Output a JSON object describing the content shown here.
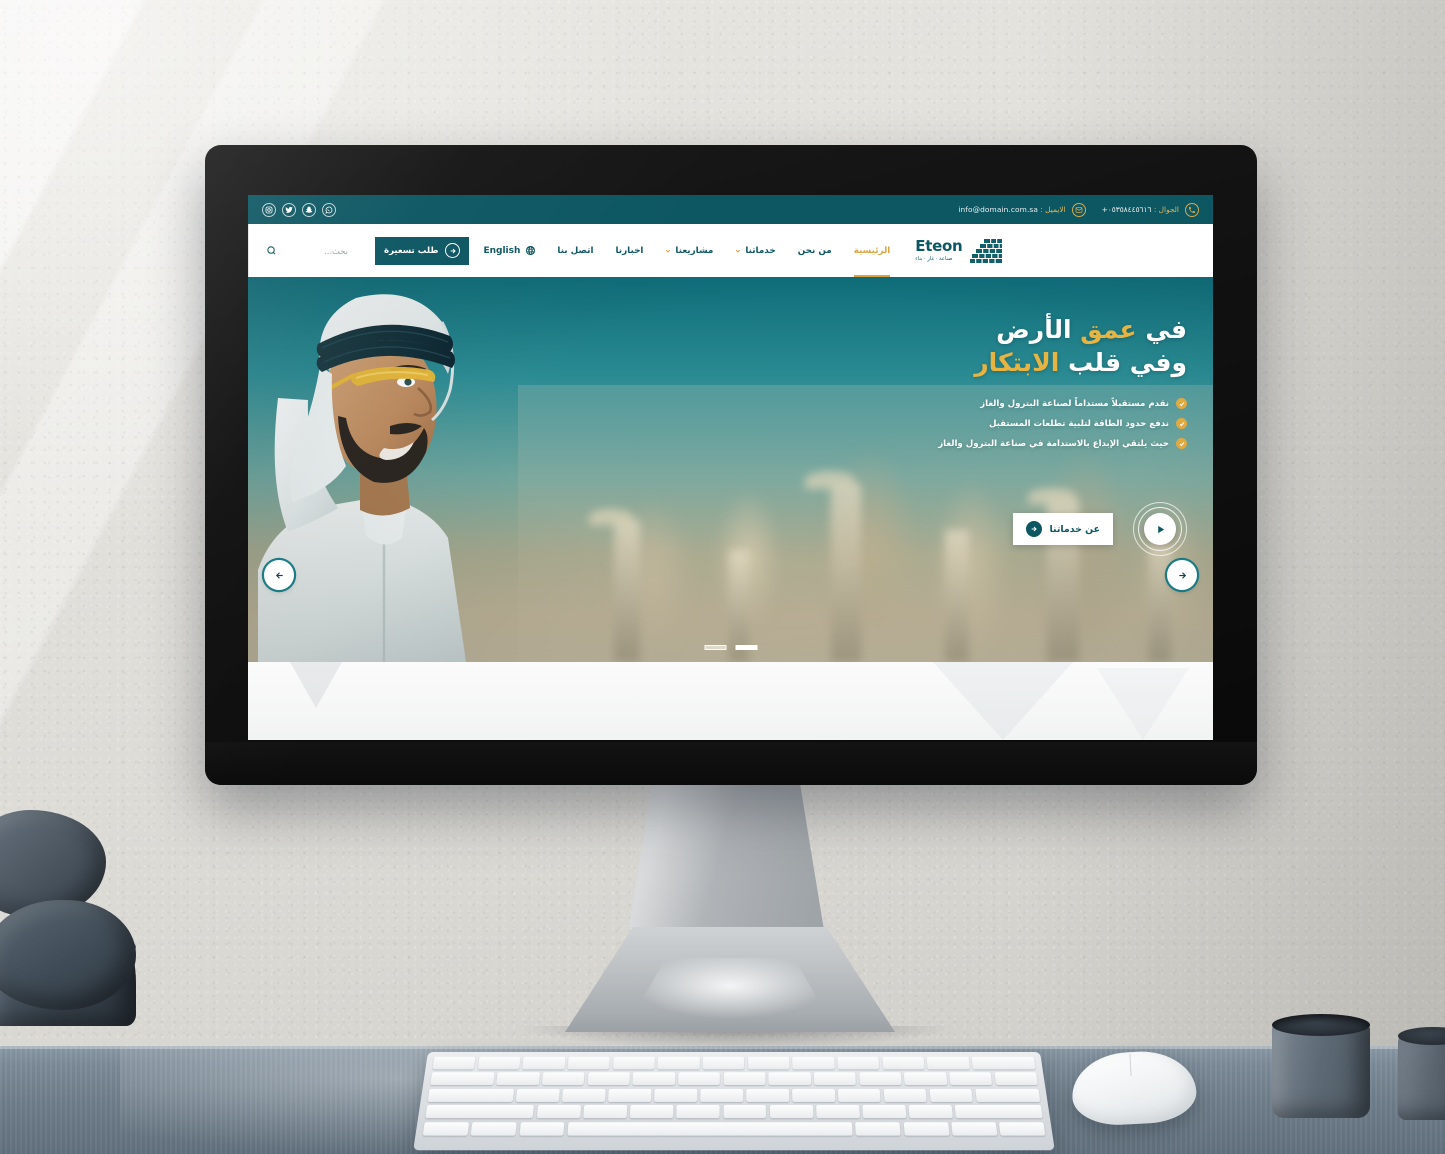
{
  "topbar": {
    "social": [
      {
        "name": "instagram-icon",
        "label": "Instagram"
      },
      {
        "name": "twitter-icon",
        "label": "Twitter"
      },
      {
        "name": "snapchat-icon",
        "label": "Snapchat"
      },
      {
        "name": "whatsapp-icon",
        "label": "WhatsApp"
      }
    ],
    "phone_label": "الجوال :",
    "phone_value": "٠٥٣٥٨٤٤٥٦١٦+",
    "email_label": "الايميل :",
    "email_value": "info@domain.com.sa"
  },
  "nav": {
    "search_placeholder": "بحث...",
    "quote_button": "طلب تسعيرة",
    "language": "English",
    "items": [
      {
        "label": "الرئيسية",
        "active": true,
        "dropdown": false
      },
      {
        "label": "من نحن",
        "active": false,
        "dropdown": false
      },
      {
        "label": "خدماتنا",
        "active": false,
        "dropdown": true
      },
      {
        "label": "مشاريعنا",
        "active": false,
        "dropdown": true
      },
      {
        "label": "اخبارنا",
        "active": false,
        "dropdown": false
      },
      {
        "label": "اتصل بنا",
        "active": false,
        "dropdown": false
      }
    ],
    "logo_name": "Eteon",
    "logo_sub": "صناعة · غاز · بناء"
  },
  "hero": {
    "headline_line1_pre": "في ",
    "headline_line1_gold": "عمق",
    "headline_line1_post": " الأرض",
    "headline_line2_pre": "وفي قلب ",
    "headline_line2_gold": "الابتكار",
    "bullets": [
      "نقدم مستقبلاً مستداماً لصناعة البترول والغاز",
      "ندفع حدود الطاقة لتلبية تطلعات المستقبل",
      "حيث يلتقي الإبداع بالاستدامة في صناعة البترول والغاز"
    ],
    "services_button": "عن خدماتنا",
    "play_label": "تشغيل الفيديو",
    "prev_label": "السابق",
    "next_label": "التالي",
    "slides": 2,
    "active_slide": 2
  },
  "colors": {
    "teal": "#0d5763",
    "gold": "#d9a441",
    "hero_gold": "#e7b441",
    "white": "#ffffff"
  }
}
